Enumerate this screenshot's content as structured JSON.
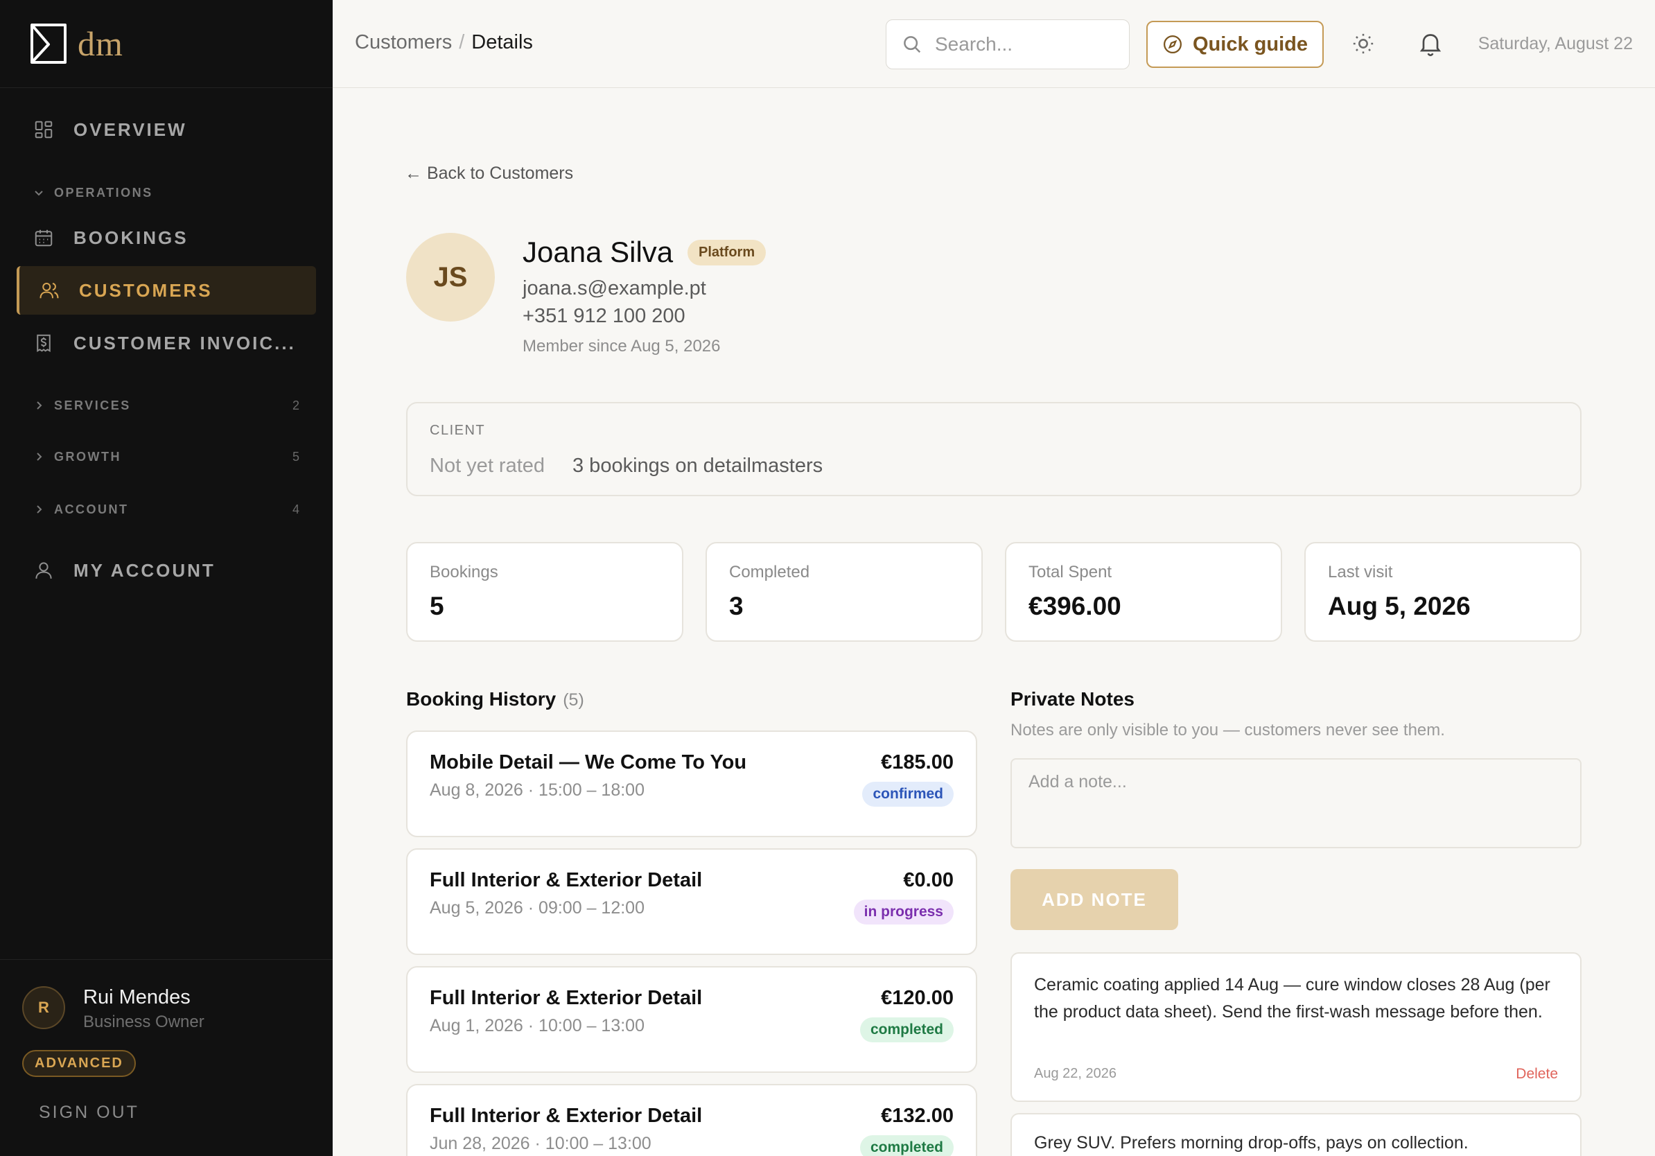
{
  "sidebar": {
    "logo_text": "dm",
    "nav_overview": "OVERVIEW",
    "sections": {
      "operations": "OPERATIONS",
      "services": {
        "label": "SERVICES",
        "count": "2"
      },
      "growth": {
        "label": "GROWTH",
        "count": "5"
      },
      "account": {
        "label": "ACCOUNT",
        "count": "4"
      }
    },
    "items": {
      "bookings": "BOOKINGS",
      "customers": "CUSTOMERS",
      "invoices": "CUSTOMER INVOIC...",
      "my_account": "MY ACCOUNT"
    },
    "user": {
      "initial": "R",
      "name": "Rui Mendes",
      "role": "Business Owner",
      "tier": "ADVANCED",
      "sign_out": "SIGN OUT"
    },
    "accent_color": "#d9a653"
  },
  "topbar": {
    "breadcrumb": {
      "parent": "Customers",
      "separator": "/",
      "current": "Details"
    },
    "search_placeholder": "Search...",
    "quick_guide": "Quick guide",
    "date": "Saturday, August 22"
  },
  "customer": {
    "back_label": "← Back to Customers",
    "initials": "JS",
    "name": "Joana Silva",
    "source_badge": "Platform",
    "email": "joana.s@example.pt",
    "phone": "+351 912 100 200",
    "member_since": "Member since Aug 5, 2026",
    "client_label": "CLIENT",
    "rating": "Not yet rated",
    "platform_bookings": "3 bookings on detailmasters"
  },
  "stats": [
    {
      "label": "Bookings",
      "value": "5"
    },
    {
      "label": "Completed",
      "value": "3"
    },
    {
      "label": "Total Spent",
      "value": "€396.00"
    },
    {
      "label": "Last visit",
      "value": "Aug 5, 2026"
    }
  ],
  "history": {
    "title": "Booking History",
    "count": "(5)",
    "items": [
      {
        "service": "Mobile Detail — We Come To You",
        "when": "Aug 8, 2026  · 15:00 – 18:00",
        "price": "€185.00",
        "status": "confirmed"
      },
      {
        "service": "Full Interior & Exterior Detail",
        "when": "Aug 5, 2026  · 09:00 – 12:00",
        "price": "€0.00",
        "status": "in progress"
      },
      {
        "service": "Full Interior & Exterior Detail",
        "when": "Aug 1, 2026  · 10:00 – 13:00",
        "price": "€120.00",
        "status": "completed"
      },
      {
        "service": "Full Interior & Exterior Detail",
        "when": "Jun 28, 2026  · 10:00 – 13:00",
        "price": "€132.00",
        "status": "completed"
      }
    ]
  },
  "notes": {
    "title": "Private Notes",
    "subtitle": "Notes are only visible to you — customers never see them.",
    "placeholder": "Add a note...",
    "add_button": "ADD NOTE",
    "items": [
      {
        "text": "Ceramic coating applied 14 Aug — cure window closes 28 Aug (per the product data sheet). Send the first-wash message before then.",
        "date": "Aug 22, 2026",
        "delete": "Delete"
      },
      {
        "text": "Grey SUV. Prefers morning drop-offs, pays on collection."
      }
    ]
  }
}
